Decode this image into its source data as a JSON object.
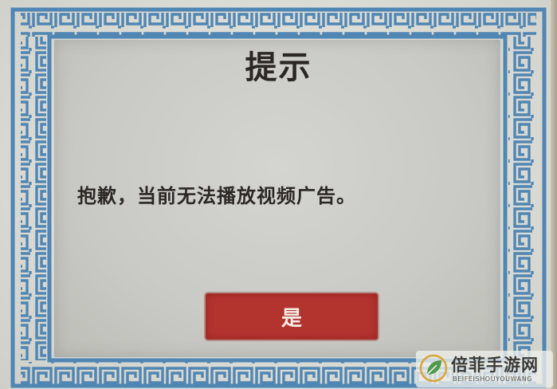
{
  "dialog": {
    "title": "提示",
    "message": "抱歉，当前无法播放视频广告。",
    "confirm_label": "是"
  },
  "watermark": {
    "name": "倍菲手游网",
    "subtitle": "BEIFEISHOUYOUWANG"
  },
  "colors": {
    "border_blue": "#4f86b3",
    "button_red": "#b3332f",
    "paper": "#dcdcd7",
    "text": "#2a2724"
  },
  "icons": {
    "border": "greek-key-border",
    "watermark_logo": "leaf-logo-icon"
  }
}
